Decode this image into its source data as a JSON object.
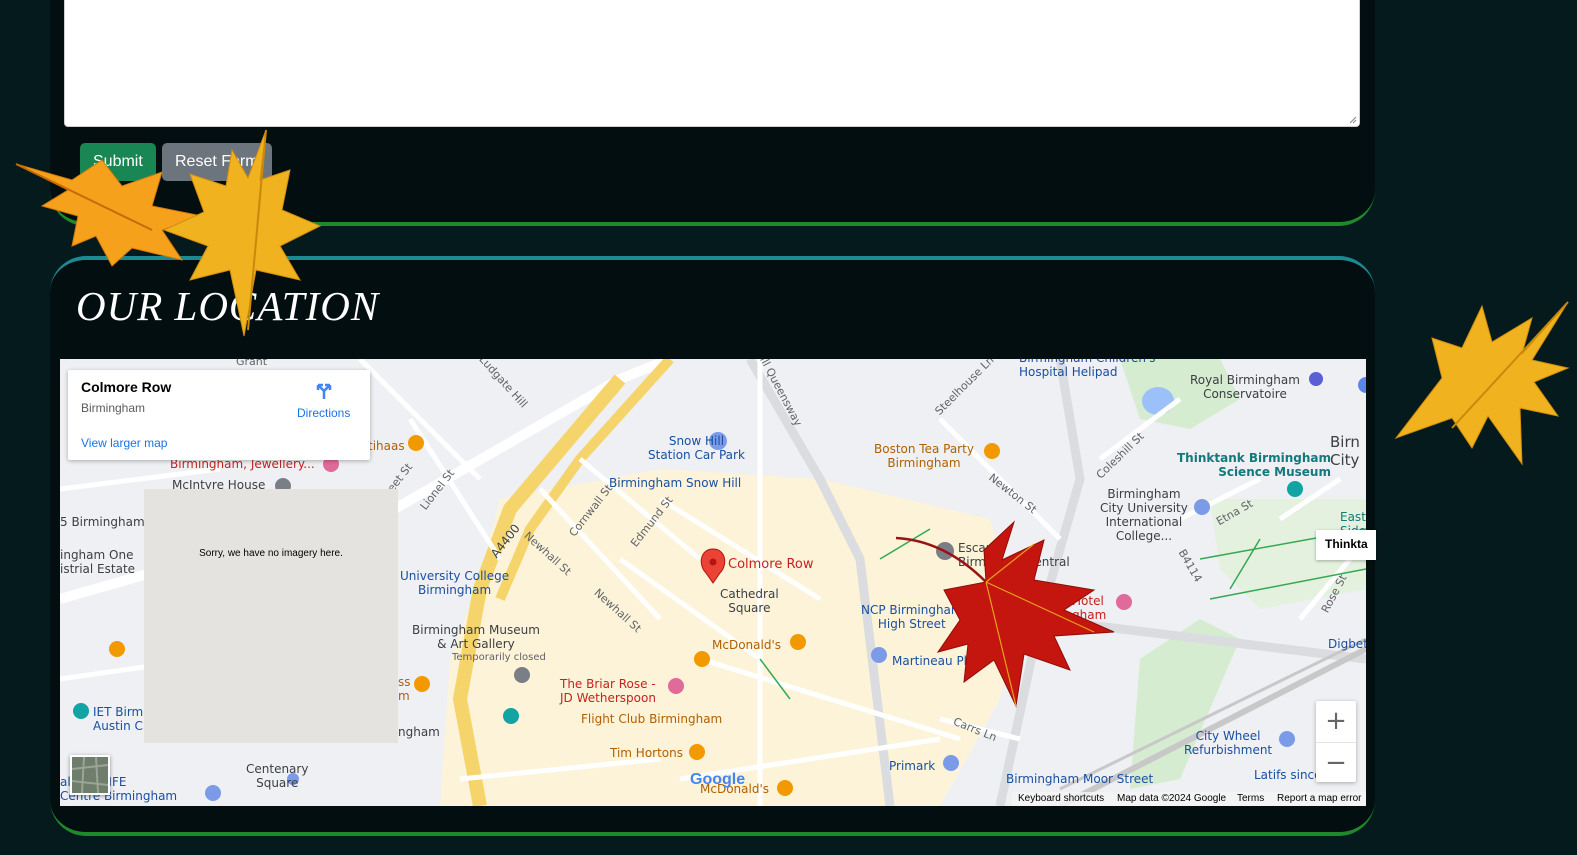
{
  "form": {
    "submit_label": "Submit",
    "reset_label": "Reset Form"
  },
  "section": {
    "title": "OUR LOCATION"
  },
  "map": {
    "card": {
      "place_name": "Colmore Row",
      "place_city": "Birmingham",
      "directions_label": "Directions",
      "larger_map_label": "View larger map"
    },
    "no_imagery_text": "Sorry, we have no imagery here.",
    "marker_label": "Colmore Row",
    "streetview_chip": "Thinkta",
    "zoom_in": "+",
    "zoom_out": "−",
    "google_logo": "Google",
    "footer": {
      "keyboard": "Keyboard shortcuts",
      "map_data": "Map data ©2024 Google",
      "terms": "Terms",
      "report": "Report a map error"
    },
    "labels": {
      "snow_hill_car_park": "Snow Hill\nStation Car Park",
      "snow_hill_station": "Birmingham Snow Hill",
      "boston_tea_party": "Boston Tea Party\nBirmingham",
      "childrens_hospital": "Birmingham Children's\nHospital Helipad",
      "royal_conservatoire": "Royal Birmingham\nConservatoire",
      "thinktank": "Thinktank Birmingham\nScience Museum",
      "bcu": "Birmingham\nCity University\nInternational\nCollege...",
      "cathedral_square": "Cathedral\nSquare",
      "mcdonalds_1": "McDonald's",
      "mcdonalds_2": "McDonald's",
      "ncp": "NCP Birmingham\nHigh Street",
      "martineau": "Martineau Place",
      "briar_rose": "The Briar Rose -\nJD Wetherspoon",
      "flight_club": "Flight Club Birmingham",
      "tim_hortons": "Tim Hortons",
      "primark": "Primark",
      "moor_street": "Birmingham Moor Street",
      "city_wheel": "City Wheel\nRefurbishment",
      "latifs": "Latifs since",
      "museum": "Birmingham Museum\n& Art Gallery",
      "temp_closed": "Temporarily closed",
      "ucb": "University College\nBirmingham",
      "jewellery": "Birmingham, Jewellery...",
      "mcintyre": "McIntyre House",
      "centenary": "Centenary\nSquare",
      "sea_life": "al SEA LIFE\nCentre Birmingham",
      "iet": "IET Birm\nAustin C",
      "one_industrial": "ingham One\nistrial Estate",
      "birmingham_5": "5  Birmingham",
      "digbeth": "Digbeth E",
      "east_side": "East\nSide",
      "birm_city": "Birn\nCity",
      "ihaas": "tihaas",
      "escape": "Escape\nBirm",
      "central": "Central",
      "hotel": "Hotel\ngham",
      "gham": "ngham",
      "ss": "ss\nm",
      "street_ludgate": "Ludgate Hill",
      "street_lionel": "Lionel St",
      "street_a4400": "A4400",
      "street_cornwall": "Cornwall St",
      "street_edmund": "Edmund St",
      "street_newhall_1": "Newhall St",
      "street_newhall_2": "Newhall St",
      "street_newton": "Newton St",
      "street_coleshill": "Coleshill St",
      "street_etna": "Etna St",
      "street_b4114": "B4114",
      "street_rose": "Rose St",
      "street_carrs": "Carrs Ln",
      "street_steelhouse": "Steelhouse Ln",
      "street_queensway": "Hill Queensway",
      "street_fleet": "eet St",
      "street_grant": "Grant"
    }
  },
  "colors": {
    "page_bg": "#051a1c",
    "panel_bg": "#020e10",
    "green_rule": "#1f8a2c",
    "teal_rule": "#1c8a92",
    "submit_bg": "#198754",
    "reset_bg": "#6c757d",
    "marker_red": "#ea4335"
  }
}
